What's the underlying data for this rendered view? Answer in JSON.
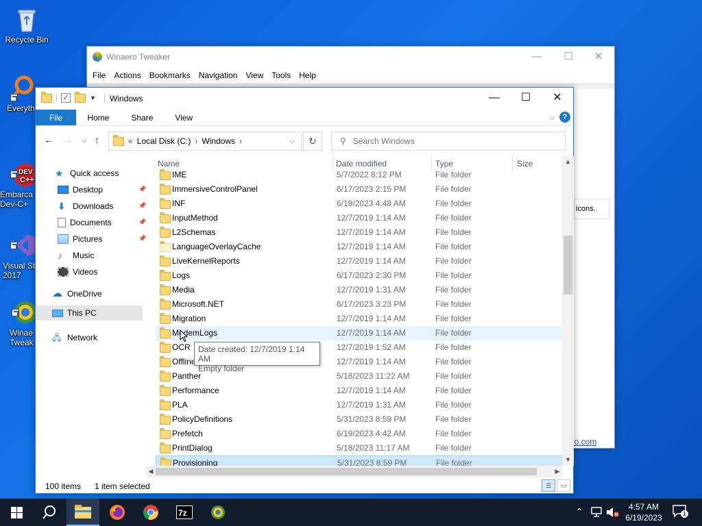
{
  "desktop": {
    "icons": [
      {
        "label": "Recycle Bin"
      },
      {
        "label": "Everyth"
      },
      {
        "label": "Embarca\nDev-C+"
      },
      {
        "label": "Visual St\n2017"
      },
      {
        "label": "Winae\nTweak"
      }
    ]
  },
  "winaero": {
    "title": "Winaero Tweaker",
    "menu": [
      "File",
      "Actions",
      "Bookmarks",
      "Navigation",
      "View",
      "Tools",
      "Help"
    ],
    "icons_text": "icons.",
    "link": "ero.com"
  },
  "explorer": {
    "title": "Windows",
    "ribbon_tabs": [
      "File",
      "Home",
      "Share",
      "View"
    ],
    "address": {
      "prefix": "«",
      "segments": [
        "Local Disk (C:)",
        "Windows"
      ]
    },
    "search_placeholder": "Search Windows",
    "nav": {
      "quick_access": "Quick access",
      "items": [
        "Desktop",
        "Downloads",
        "Documents",
        "Pictures",
        "Music",
        "Videos"
      ],
      "onedrive": "OneDrive",
      "this_pc": "This PC",
      "network": "Network"
    },
    "columns": [
      "Name",
      "Date modified",
      "Type",
      "Size"
    ],
    "rows": [
      {
        "name": "IME",
        "date": "5/7/2022 8:12 PM",
        "type": "File folder"
      },
      {
        "name": "ImmersiveControlPanel",
        "date": "6/17/2023 2:15 PM",
        "type": "File folder"
      },
      {
        "name": "INF",
        "date": "6/19/2023 4:48 AM",
        "type": "File folder"
      },
      {
        "name": "InputMethod",
        "date": "12/7/2019 1:14 AM",
        "type": "File folder"
      },
      {
        "name": "L2Schemas",
        "date": "12/7/2019 1:14 AM",
        "type": "File folder"
      },
      {
        "name": "LanguageOverlayCache",
        "date": "12/7/2019 1:14 AM",
        "type": "File folder"
      },
      {
        "name": "LiveKernelReports",
        "date": "12/7/2019 1:14 AM",
        "type": "File folder"
      },
      {
        "name": "Logs",
        "date": "6/17/2023 2:30 PM",
        "type": "File folder"
      },
      {
        "name": "Media",
        "date": "12/7/2019 1:31 AM",
        "type": "File folder"
      },
      {
        "name": "Microsoft.NET",
        "date": "6/17/2023 3:23 PM",
        "type": "File folder"
      },
      {
        "name": "Migration",
        "date": "12/7/2019 1:14 AM",
        "type": "File folder"
      },
      {
        "name": "ModemLogs",
        "date": "12/7/2019 1:14 AM",
        "type": "File folder"
      },
      {
        "name": "OCR",
        "date": "12/7/2019 1:52 AM",
        "type": "File folder"
      },
      {
        "name": "Offline",
        "date": "12/7/2019 1:14 AM",
        "type": "File folder"
      },
      {
        "name": "Panther",
        "date": "5/18/2023 11:22 AM",
        "type": "File folder"
      },
      {
        "name": "Performance",
        "date": "12/7/2019 1:14 AM",
        "type": "File folder"
      },
      {
        "name": "PLA",
        "date": "12/7/2019 1:31 AM",
        "type": "File folder"
      },
      {
        "name": "PolicyDefinitions",
        "date": "5/31/2023 8:59 PM",
        "type": "File folder"
      },
      {
        "name": "Prefetch",
        "date": "6/19/2023 4:42 AM",
        "type": "File folder"
      },
      {
        "name": "PrintDialog",
        "date": "5/18/2023 11:17 AM",
        "type": "File folder"
      },
      {
        "name": "Provisioning",
        "date": "5/31/2023 8:59 PM",
        "type": "File folder"
      }
    ],
    "tooltip": {
      "line1": "Date created: 12/7/2019 1:14 AM",
      "line2": "Empty folder"
    },
    "status": {
      "count": "100 items",
      "selected": "1 item selected"
    }
  },
  "taskbar": {
    "clock_time": "4:57 AM",
    "clock_date": "6/19/2023",
    "notification_count": "1"
  }
}
